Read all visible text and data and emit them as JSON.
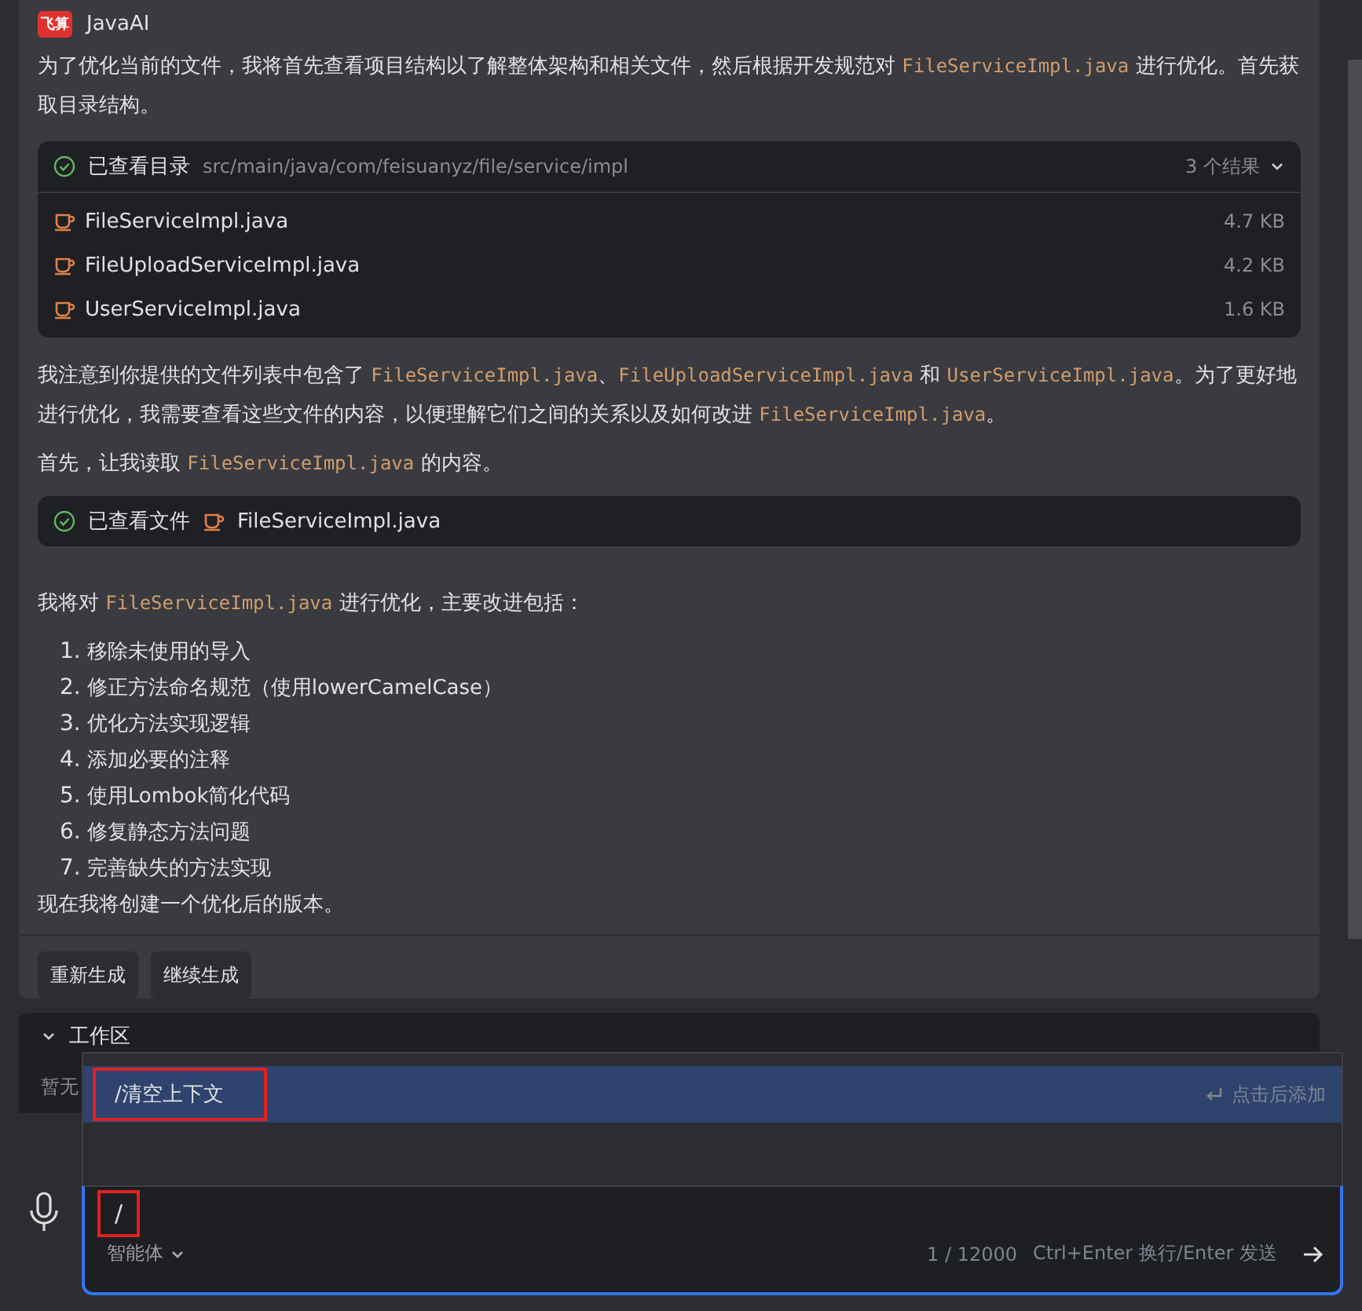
{
  "message": {
    "sender": "JavaAI",
    "logo": "飞算",
    "intro": [
      {
        "kind": "text",
        "text": "为了优化当前的文件，我将首先查看项目结构以了解整体架构和相关文件，然后根据开发规范对 "
      },
      {
        "kind": "code",
        "text": "FileServiceImpl.java"
      },
      {
        "kind": "text",
        "text": " 进行优化。首先获取目录结构。"
      }
    ],
    "directory_tool": {
      "label": "已查看目录",
      "path": "src/main/java/com/feisuanyz/file/service/impl",
      "result_count": "3 个结果",
      "expanded": true,
      "files": [
        {
          "name": "FileServiceImpl.java",
          "size": "4.7 KB"
        },
        {
          "name": "FileUploadServiceImpl.java",
          "size": "4.2 KB"
        },
        {
          "name": "UserServiceImpl.java",
          "size": "1.6 KB"
        }
      ]
    },
    "paragraphs": [
      [
        {
          "kind": "text",
          "text": "我注意到你提供的文件列表中包含了 "
        },
        {
          "kind": "code",
          "text": "FileServiceImpl.java"
        },
        {
          "kind": "text",
          "text": "、"
        },
        {
          "kind": "code",
          "text": "FileUploadServiceImpl.java"
        },
        {
          "kind": "text",
          "text": " 和 "
        },
        {
          "kind": "code",
          "text": "UserServiceImpl.java"
        },
        {
          "kind": "text",
          "text": "。为了更好地进行优化，我需要查看这些文件的内容，以便理解它们之间的关系以及如何改进 "
        },
        {
          "kind": "code",
          "text": "FileServiceImpl.java"
        },
        {
          "kind": "text",
          "text": "。"
        }
      ],
      [
        {
          "kind": "text",
          "text": "首先，让我读取 "
        },
        {
          "kind": "code",
          "text": "FileServiceImpl.java"
        },
        {
          "kind": "text",
          "text": " 的内容。"
        }
      ]
    ],
    "file_tool": {
      "label": "已查看文件",
      "file": "FileServiceImpl.java"
    },
    "plan_intro": [
      {
        "kind": "text",
        "text": "我将对 "
      },
      {
        "kind": "code",
        "text": "FileServiceImpl.java"
      },
      {
        "kind": "text",
        "text": " 进行优化，主要改进包括："
      }
    ],
    "plan_items": [
      {
        "number": "1.",
        "text": "移除未使用的导入"
      },
      {
        "number": "2.",
        "text": "修正方法命名规范（使用lowerCamelCase）"
      },
      {
        "number": "3.",
        "text": "优化方法实现逻辑"
      },
      {
        "number": "4.",
        "text": "添加必要的注释"
      },
      {
        "number": "5.",
        "text": "使用Lombok简化代码"
      },
      {
        "number": "6.",
        "text": "修复静态方法问题"
      },
      {
        "number": "7.",
        "text": "完善缺失的方法实现"
      }
    ],
    "closing": "现在我将创建一个优化后的版本。",
    "actions": [
      "重新生成",
      "继续生成"
    ]
  },
  "workspace": {
    "title": "工作区",
    "expanded": true,
    "empty_text": "暂无"
  },
  "command_popup": {
    "items": [
      {
        "command": "/清空上下文",
        "hint": "点击后添加",
        "selected": true,
        "annotated": true
      }
    ]
  },
  "input": {
    "value": "/",
    "annotated": true,
    "agent": "智能体",
    "counter": "1 / 12000",
    "shortcut_hint": "Ctrl+Enter 换行/Enter 发送",
    "focused": true
  }
}
